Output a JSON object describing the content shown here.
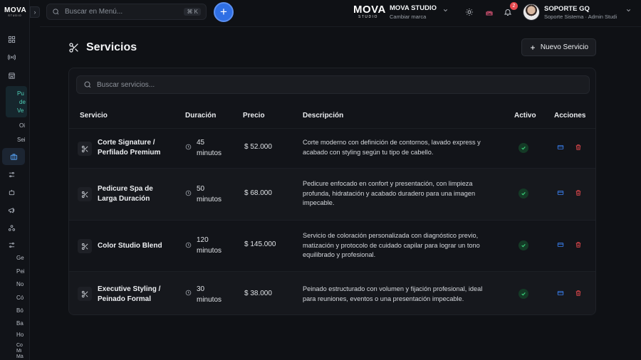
{
  "sidebar": {
    "logo_line1": "MOVA",
    "logo_line2": "STUDIO",
    "toggle": "›",
    "texts": [
      "Pu",
      "de",
      "Ve",
      "Oi",
      "Sei",
      "Ge",
      "Pei",
      "No",
      "Có",
      "Bó",
      "Ba",
      "Ho",
      "Co",
      "Mi",
      "Má"
    ]
  },
  "topbar": {
    "search_placeholder": "Buscar en Menú...",
    "shortcut": "⌘ K",
    "plus": "+",
    "brand_logo1": "MOVA",
    "brand_logo2": "STUDIO",
    "brand_name": "MOVA STUDIO",
    "brand_sub": "Cambiar marca",
    "notifications": "2",
    "user_name": "SOPORTE GQ",
    "user_role": "Soporte Sistema  ·  Admin Studi"
  },
  "page": {
    "title": "Servicios",
    "new_button": "Nuevo Servicio",
    "search_placeholder": "Buscar servicios..."
  },
  "table": {
    "headers": [
      "Servicio",
      "Duración",
      "Precio",
      "Descripción",
      "Activo",
      "Acciones"
    ],
    "rows": [
      {
        "name_1": "Corte Signature /",
        "name_2": "Perfilado Premium",
        "dur_1": "45",
        "dur_2": "minutos",
        "price": "$  52.000",
        "desc": "Corte moderno con definición de contornos, lavado express y acabado con styling según tu tipo de cabello."
      },
      {
        "name_1": "Pedicure Spa de",
        "name_2": "Larga Duración",
        "dur_1": "50",
        "dur_2": "minutos",
        "price": "$  68.000",
        "desc": "Pedicure enfocado en confort y presentación, con limpieza profunda, hidratación y acabado duradero para una imagen impecable."
      },
      {
        "name_1": "Color Studio Blend",
        "name_2": "",
        "dur_1": "120",
        "dur_2": "minutos",
        "price": "$  145.000",
        "desc": "Servicio de coloración personalizada con diagnóstico previo, matización y protocolo de cuidado capilar para lograr un tono equilibrado y profesional."
      },
      {
        "name_1": "Executive Styling /",
        "name_2": "Peinado Formal",
        "dur_1": "30",
        "dur_2": "minutos",
        "price": "$  38.000",
        "desc": "Peinado estructurado con volumen y fijación profesional, ideal para reuniones, eventos o una presentación impecable."
      }
    ]
  },
  "colors": {
    "accent_blue": "#2f6fe4",
    "active_green": "#3ad07a",
    "delete_red": "#e5484d",
    "sidebar_teal": "#4fd1b8"
  }
}
